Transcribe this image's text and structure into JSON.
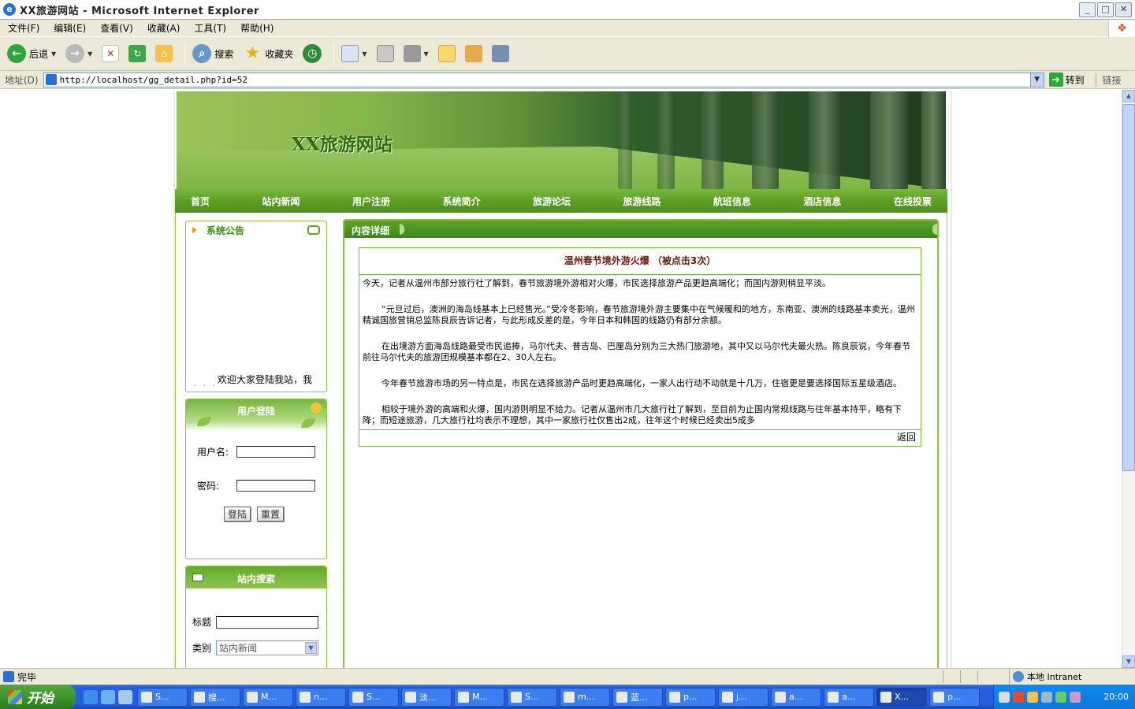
{
  "window": {
    "title": "XX旅游网站 - Microsoft Internet Explorer",
    "minimize": "_",
    "maximize": "□",
    "close": "✕"
  },
  "menu": [
    "文件(F)",
    "编辑(E)",
    "查看(V)",
    "收藏(A)",
    "工具(T)",
    "帮助(H)"
  ],
  "toolbar": {
    "back": "后退",
    "search": "搜索",
    "favorites": "收藏夹"
  },
  "address": {
    "label": "地址(D)",
    "url": "http://localhost/gg_detail.php?id=52",
    "go": "转到",
    "links": "链接"
  },
  "site": {
    "title": "XX旅游网站",
    "nav": [
      "首页",
      "站内新闻",
      "用户注册",
      "系统简介",
      "旅游论坛",
      "旅游线路",
      "航班信息",
      "酒店信息",
      "在线投票"
    ],
    "notice": {
      "heading": "系统公告",
      "marquee": "欢迎大家登陆我站，我"
    },
    "login": {
      "heading": "用户登陆",
      "username_label": "用户名:",
      "password_label": "密码:",
      "submit": "登陆",
      "reset": "重置"
    },
    "search": {
      "heading": "站内搜索",
      "title_label": "标题",
      "category_label": "类别",
      "category_value": "站内新闻"
    },
    "detail": {
      "heading": "内容详细",
      "article_title": "温州春节境外游火爆 （被点击3次）",
      "paragraphs": [
        "今天，记者从温州市部分旅行社了解到，春节旅游境外游相对火爆，市民选择旅游产品更趋高端化；而国内游则稍显平淡。",
        "“元旦过后，澳洲的海岛线基本上已经售光。”受冷冬影响，春节旅游境外游主要集中在气候暖和的地方，东南亚、澳洲的线路基本卖光，温州精诚国旅营销总监陈良辰告诉记者，与此形成反差的是，今年日本和韩国的线路仍有部分余额。",
        "在出境游方面海岛线路最受市民追捧，马尔代夫、普吉岛、巴厘岛分别为三大热门旅游地，其中又以马尔代夫最火热。陈良辰说，今年春节前往马尔代夫的旅游团规模基本都在2、30人左右。",
        "今年春节旅游市场的另一特点是，市民在选择旅游产品时更趋高端化，一家人出行动不动就是十几万，住宿更是要选择国际五星级酒店。",
        "相较于境外游的高端和火爆，国内游则明显不给力。记者从温州市几大旅行社了解到，至目前为止国内常规线路与往年基本持平，略有下降；而短途旅游，几大旅行社均表示不理想，其中一家旅行社仅售出2成，往年这个时候已经卖出5成多"
      ],
      "back": "返回"
    }
  },
  "status": {
    "text": "完毕",
    "zone": "本地 Intranet"
  },
  "taskbar": {
    "start": "开始",
    "tasks": [
      "S...",
      "搜...",
      "M...",
      "n...",
      "S...",
      "淡...",
      "M...",
      "S...",
      "m...",
      "蓝...",
      "p...",
      "j...",
      "a...",
      "a...",
      "X...",
      "p..."
    ],
    "clock": "20:00"
  }
}
